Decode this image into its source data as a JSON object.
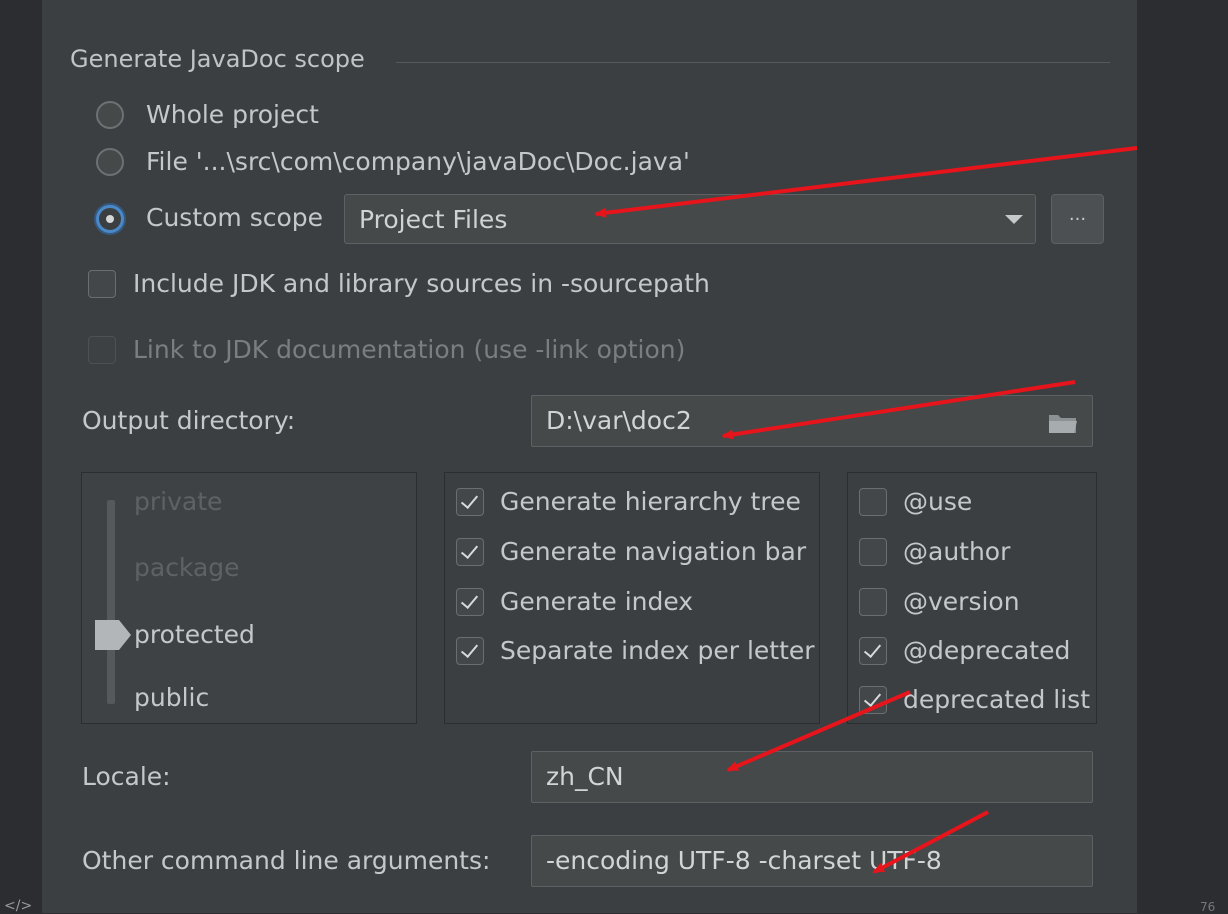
{
  "scope": {
    "title": "Generate JavaDoc scope",
    "options": [
      {
        "label": "Whole project",
        "checked": false
      },
      {
        "label": "File '...\\src\\com\\company\\javaDoc\\Doc.java'",
        "checked": false
      },
      {
        "label": "Custom scope",
        "checked": true
      }
    ],
    "custom_scope_value": "Project Files",
    "browse_label": "..."
  },
  "include_jdk": {
    "label": "Include JDK and library sources in -sourcepath",
    "checked": false
  },
  "link_jdk": {
    "label": "Link to JDK documentation (use -link option)",
    "checked": false,
    "enabled": false
  },
  "output": {
    "label": "Output directory:",
    "value": "D:\\var\\doc2"
  },
  "access_levels": {
    "items": [
      "private",
      "package",
      "protected",
      "public"
    ],
    "selected": "protected"
  },
  "generate_options": [
    {
      "label": "Generate hierarchy tree",
      "checked": true
    },
    {
      "label": "Generate navigation bar",
      "checked": true
    },
    {
      "label": "Generate index",
      "checked": true
    },
    {
      "label": "Separate index per letter",
      "checked": true
    }
  ],
  "tags": [
    {
      "label": "@use",
      "checked": false
    },
    {
      "label": "@author",
      "checked": false
    },
    {
      "label": "@version",
      "checked": false
    },
    {
      "label": "@deprecated",
      "checked": true
    },
    {
      "label": "deprecated list",
      "checked": true
    }
  ],
  "locale": {
    "label": "Locale:",
    "value": "zh_CN"
  },
  "other_args": {
    "label": "Other command line arguments:",
    "value": "-encoding UTF-8 -charset UTF-8"
  },
  "footer": {
    "left": "</>",
    "right": "76"
  },
  "colors": {
    "annotation_arrow": "#e8141b",
    "focus_ring": "#4a88c7",
    "panel": "#3c3f41"
  }
}
